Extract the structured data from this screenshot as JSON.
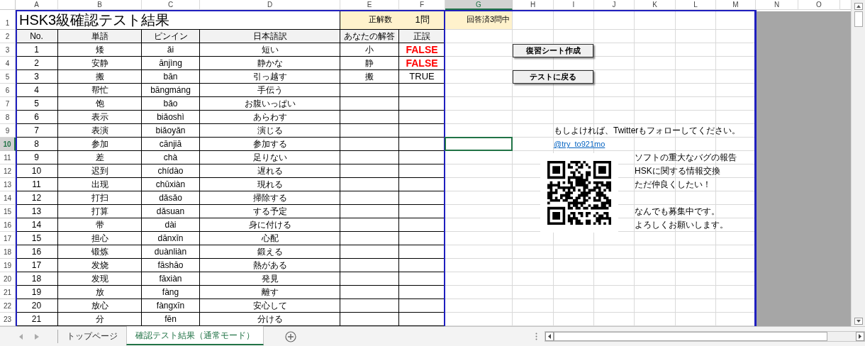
{
  "column_letters": [
    {
      "label": "A",
      "selected": false
    },
    {
      "label": "B",
      "selected": false
    },
    {
      "label": "C",
      "selected": false
    },
    {
      "label": "D",
      "selected": false
    },
    {
      "label": "E",
      "selected": false
    },
    {
      "label": "F",
      "selected": false
    },
    {
      "label": "G",
      "selected": true
    },
    {
      "label": "H",
      "selected": false
    },
    {
      "label": "I",
      "selected": false
    },
    {
      "label": "J",
      "selected": false
    },
    {
      "label": "K",
      "selected": false
    },
    {
      "label": "L",
      "selected": false
    },
    {
      "label": "M",
      "selected": false
    },
    {
      "label": "N",
      "selected": false
    },
    {
      "label": "O",
      "selected": false
    }
  ],
  "row_numbers": [
    {
      "label": "1",
      "selected": false
    },
    {
      "label": "2",
      "selected": false
    },
    {
      "label": "3",
      "selected": false
    },
    {
      "label": "4",
      "selected": false
    },
    {
      "label": "5",
      "selected": false
    },
    {
      "label": "6",
      "selected": false
    },
    {
      "label": "7",
      "selected": false
    },
    {
      "label": "8",
      "selected": false
    },
    {
      "label": "9",
      "selected": false
    },
    {
      "label": "10",
      "selected": true
    },
    {
      "label": "11",
      "selected": false
    },
    {
      "label": "12",
      "selected": false
    },
    {
      "label": "13",
      "selected": false
    },
    {
      "label": "14",
      "selected": false
    },
    {
      "label": "15",
      "selected": false
    },
    {
      "label": "16",
      "selected": false
    },
    {
      "label": "17",
      "selected": false
    },
    {
      "label": "18",
      "selected": false
    },
    {
      "label": "19",
      "selected": false
    },
    {
      "label": "20",
      "selected": false
    },
    {
      "label": "21",
      "selected": false
    },
    {
      "label": "22",
      "selected": false
    },
    {
      "label": "23",
      "selected": false
    }
  ],
  "title": "HSK3級確認テスト結果",
  "score": {
    "label": "正解数",
    "value": "1問"
  },
  "answered": "回答済3問中",
  "table": {
    "columns": [
      "No.",
      "単語",
      "ピンイン",
      "日本語訳",
      "あなたの解答",
      "正誤"
    ],
    "rows": [
      {
        "no": "1",
        "word": "矮",
        "pinyin": "ǎi",
        "japanese": "短い",
        "answer": "小",
        "result": "FALSE",
        "correct": false
      },
      {
        "no": "2",
        "word": "安静",
        "pinyin": "ānjìng",
        "japanese": "静かな",
        "answer": "静",
        "result": "FALSE",
        "correct": false
      },
      {
        "no": "3",
        "word": "搬",
        "pinyin": "bān",
        "japanese": "引っ越す",
        "answer": "搬",
        "result": "TRUE",
        "correct": true
      },
      {
        "no": "4",
        "word": "帮忙",
        "pinyin": "bāngmáng",
        "japanese": "手伝う"
      },
      {
        "no": "5",
        "word": "饱",
        "pinyin": "bǎo",
        "japanese": "お腹いっぱい"
      },
      {
        "no": "6",
        "word": "表示",
        "pinyin": "biǎoshì",
        "japanese": "あらわす"
      },
      {
        "no": "7",
        "word": "表演",
        "pinyin": "biǎoyǎn",
        "japanese": "演じる"
      },
      {
        "no": "8",
        "word": "参加",
        "pinyin": "cānjiā",
        "japanese": "参加する"
      },
      {
        "no": "9",
        "word": "差",
        "pinyin": "chà",
        "japanese": "足りない"
      },
      {
        "no": "10",
        "word": "迟到",
        "pinyin": "chídào",
        "japanese": "遅れる"
      },
      {
        "no": "11",
        "word": "出现",
        "pinyin": "chūxiàn",
        "japanese": "現れる"
      },
      {
        "no": "12",
        "word": "打扫",
        "pinyin": "dǎsǎo",
        "japanese": "掃除する"
      },
      {
        "no": "13",
        "word": "打算",
        "pinyin": "dǎsuan",
        "japanese": "する予定"
      },
      {
        "no": "14",
        "word": "带",
        "pinyin": "dài",
        "japanese": "身に付ける"
      },
      {
        "no": "15",
        "word": "担心",
        "pinyin": "dānxīn",
        "japanese": "心配"
      },
      {
        "no": "16",
        "word": "锻炼",
        "pinyin": "duànliàn",
        "japanese": "鍛える"
      },
      {
        "no": "17",
        "word": "发烧",
        "pinyin": "fāshāo",
        "japanese": "熱がある"
      },
      {
        "no": "18",
        "word": "发现",
        "pinyin": "fāxiàn",
        "japanese": "発見"
      },
      {
        "no": "19",
        "word": "放",
        "pinyin": "fàng",
        "japanese": "離す"
      },
      {
        "no": "20",
        "word": "放心",
        "pinyin": "fàngxīn",
        "japanese": "安心して"
      },
      {
        "no": "21",
        "word": "分",
        "pinyin": "fēn",
        "japanese": "分ける"
      }
    ]
  },
  "buttons": [
    "復習シート作成",
    "テストに戻る"
  ],
  "follow_text": "もしよければ、Twitterもフォローしてください。",
  "twitter_link": "@try_to921mo",
  "notes": [
    [
      "ソフトの重大なバグの報告",
      "HSKに関する情報交換",
      "ただ仲良くしたい！"
    ],
    [
      "なんでも募集中です。",
      "よろしくお願いします。"
    ]
  ],
  "sheet_tabs": [
    {
      "label": "トップページ",
      "selected": false
    },
    {
      "label": "確認テスト結果（通常モード）",
      "selected": true
    }
  ]
}
